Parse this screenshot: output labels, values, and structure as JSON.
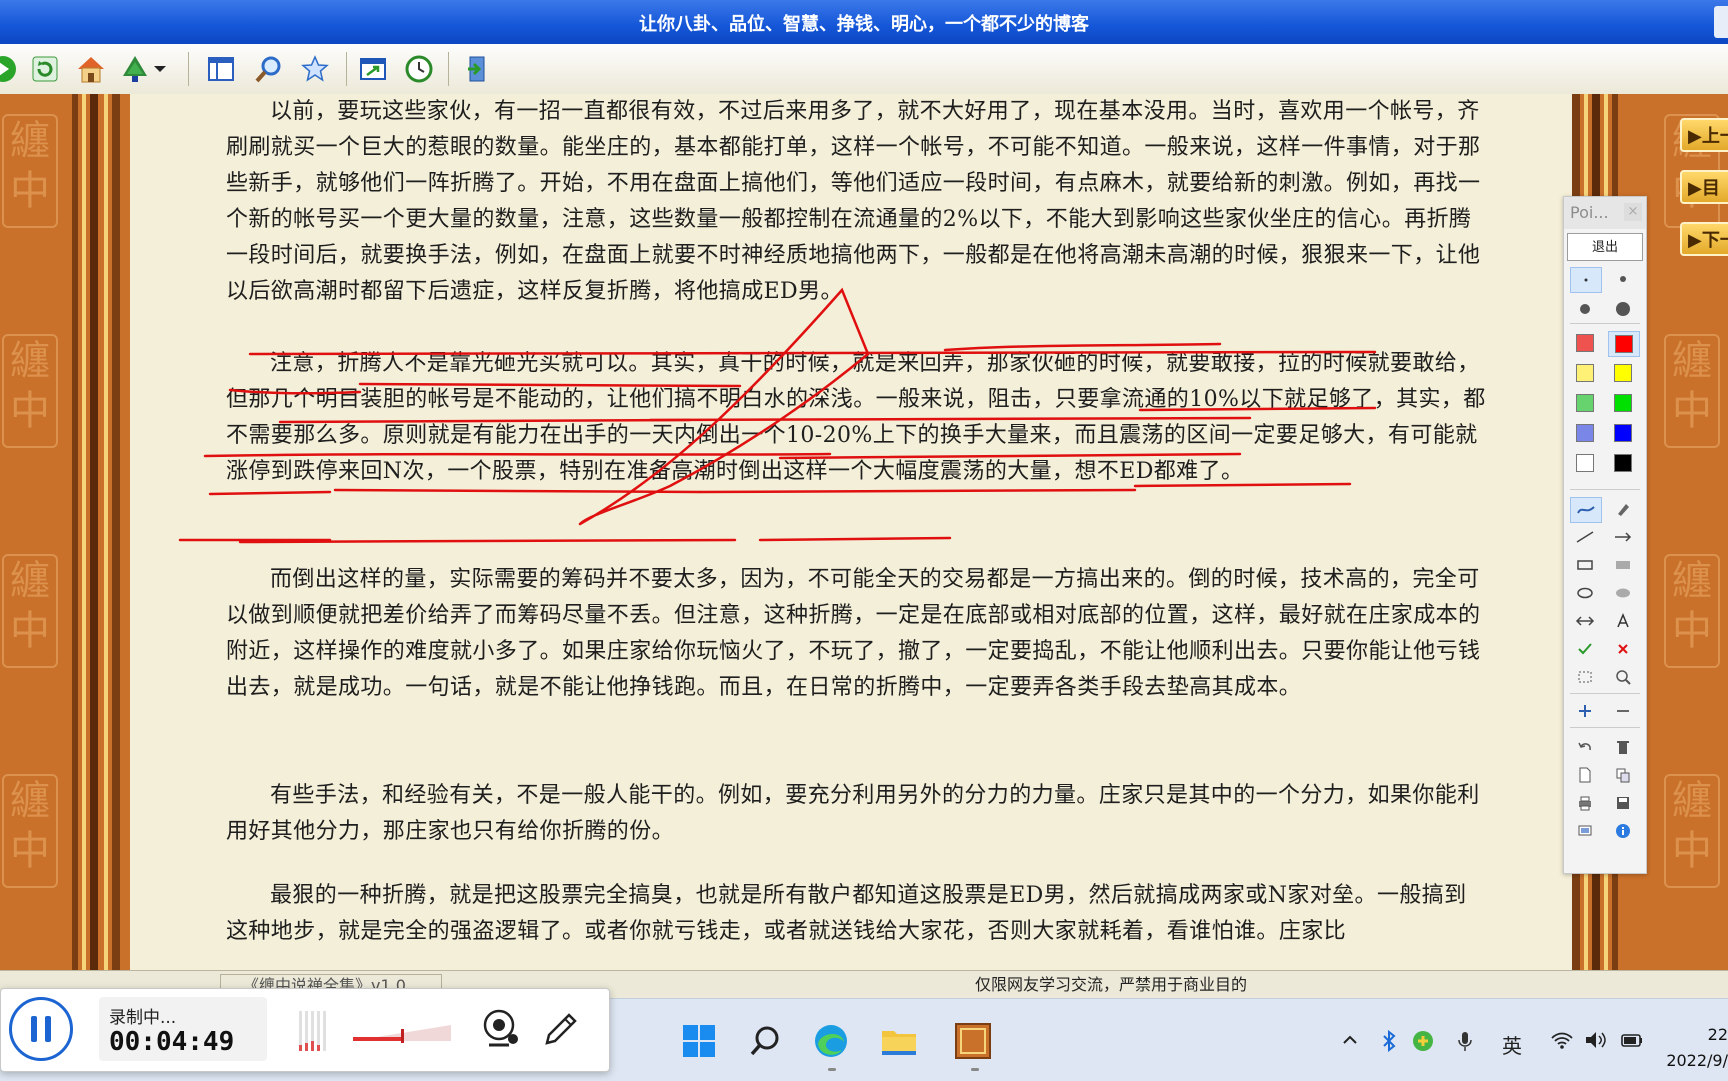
{
  "window": {
    "title": "让你八卦、品位、智慧、挣钱、明心，一个都不少的博客"
  },
  "toolbar": {
    "icons": [
      "go-forward-icon",
      "refresh-icon",
      "home-icon",
      "tree-icon",
      "dropdown-arrow-icon",
      "layout-icon",
      "search-icon",
      "favorite-star-icon",
      "window-icon",
      "history-icon",
      "exit-icon"
    ]
  },
  "article": {
    "paragraphs": [
      "以前，要玩这些家伙，有一招一直都很有效，不过后来用多了，就不大好用了，现在基本没用。当时，喜欢用一个帐号，齐刷刷就买一个巨大的惹眼的数量。能坐庄的，基本都能打单，这样一个帐号，不可能不知道。一般来说，这样一件事情，对于那些新手，就够他们一阵折腾了。开始，不用在盘面上搞他们，等他们适应一段时间，有点麻木，就要给新的刺激。例如，再找一个新的帐号买一个更大量的数量，注意，这些数量一般都控制在流通量的2%以下，不能大到影响这些家伙坐庄的信心。再折腾一段时间后，就要换手法，例如，在盘面上就要不时神经质地搞他两下，一般都是在他将高潮未高潮的时候，狠狠来一下，让他以后欲高潮时都留下后遗症，这样反复折腾，将他搞成ED男。",
      "注意，折腾人不是靠光砸光买就可以。其实，真干的时候，就是来回弄，那家伙砸的时候，就要敢接，拉的时候就要敢给，但那几个明目装胆的帐号是不能动的，让他们搞不明白水的深浅。一般来说，阻击，只要拿流通的10%以下就足够了，其实，都不需要那么多。原则就是有能力在出手的一天内倒出一个10-20%上下的换手大量来，而且震荡的区间一定要足够大，有可能就涨停到跌停来回N次，一个股票，特别在准备高潮时倒出这样一个大幅度震荡的大量，想不ED都难了。",
      "而倒出这样的量，实际需要的筹码并不要太多，因为，不可能全天的交易都是一方搞出来的。倒的时候，技术高的，完全可以做到顺便就把差价给弄了而筹码尽量不丢。但注意，这种折腾，一定是在底部或相对底部的位置，这样，最好就在庄家成本的附近，这样操作的难度就小多了。如果庄家给你玩恼火了，不玩了，撤了，一定要捣乱，不能让他顺利出去。只要你能让他亏钱出去，就是成功。一句话，就是不能让他挣钱跑。而且，在日常的折腾中，一定要弄各类手段去垫高其成本。",
      "有些手法，和经验有关，不是一般人能干的。例如，要充分利用另外的分力的力量。庄家只是其中的一个分力，如果你能利用好其他分力，那庄家也只有给你折腾的份。",
      "最狠的一种折腾，就是把这股票完全搞臭，也就是所有散户都知道这股票是ED男，然后就搞成两家或N家对垒。一般搞到这种地步，就是完全的强盗逻辑了。或者你就亏钱走，或者就送钱给大家花，否则大家就耗着，看谁怕谁。庄家比"
    ]
  },
  "nav": {
    "prev": "▶上一",
    "menu": "▶目",
    "next": "▶下一"
  },
  "palette": {
    "title": "Poi...",
    "close": "×",
    "exit_label": "退出",
    "colors": [
      "#ef5350",
      "#ff0000",
      "#fff176",
      "#ffff00",
      "#66d36e",
      "#00e000",
      "#7a86e8",
      "#0000ff",
      "#ffffff",
      "#000000"
    ]
  },
  "statusbar": {
    "book": "《缠中说禅全集》v1.0",
    "notice": "仅限网友学习交流，严禁用于商业目的"
  },
  "recorder": {
    "status": "录制中...",
    "time": "00:04:49"
  },
  "taskbar": {
    "input_method": "英",
    "clock_time": "22",
    "clock_date": "2022/9/"
  }
}
